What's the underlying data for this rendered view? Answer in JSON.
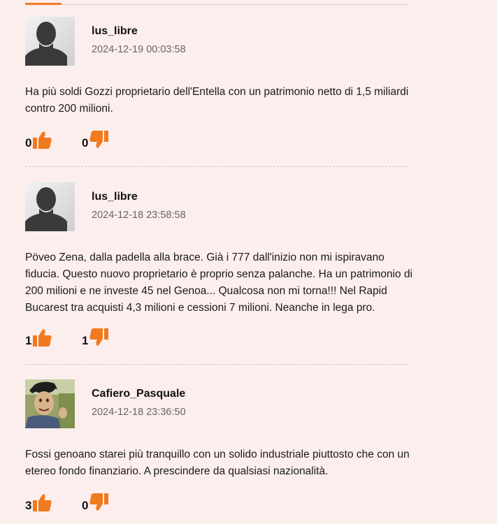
{
  "comments": [
    {
      "username": "lus_libre",
      "date": "2024-12-19 00:03:58",
      "text": "Ha più soldi Gozzi proprietario dell'Entella con un patrimonio netto di 1,5 miliardi contro 200 milioni.",
      "likes": "0",
      "dislikes": "0",
      "avatar": "silhouette"
    },
    {
      "username": "lus_libre",
      "date": "2024-12-18 23:58:58",
      "text": "Pöveo Zena, dalla padella alla brace. Già i 777 dall'inizio non mi ispiravano fiducia. Questo nuovo proprietario è proprio senza palanche. Ha un patrimonio di 200 milioni e ne investe 45 nel Genoa... Qualcosa non mi torna!!! Nel Rapid Bucarest tra acquisti 4,3 milioni e cessioni 7 milioni. Neanche in lega pro.",
      "likes": "1",
      "dislikes": "1",
      "avatar": "silhouette"
    },
    {
      "username": "Cafiero_Pasquale",
      "date": "2024-12-18 23:36:50",
      "text": "Fossi genoano starei più tranquillo con un solido industriale piuttosto che con un etereo fondo finanziario. A prescindere da qualsiasi nazionalità.",
      "likes": "3",
      "dislikes": "0",
      "avatar": "photo"
    }
  ],
  "icons": {
    "like": "thumbs-up-icon",
    "dislike": "thumbs-down-icon"
  },
  "colors": {
    "background": "#fdeeee",
    "accent": "#f07a1e"
  }
}
